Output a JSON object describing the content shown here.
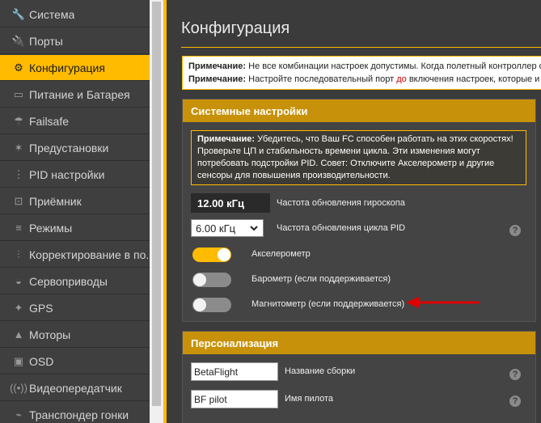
{
  "sidebar": {
    "items": [
      {
        "label": "Система",
        "icon": "wrench-icon",
        "glyph": "🔧"
      },
      {
        "label": "Порты",
        "icon": "plug-icon",
        "glyph": "🔌"
      },
      {
        "label": "Конфигурация",
        "icon": "gear-icon",
        "glyph": "⚙"
      },
      {
        "label": "Питание и Батарея",
        "icon": "battery-icon",
        "glyph": "▭"
      },
      {
        "label": "Failsafe",
        "icon": "parachute-icon",
        "glyph": "☂"
      },
      {
        "label": "Предустановки",
        "icon": "wand-icon",
        "glyph": "✶"
      },
      {
        "label": "PID настройки",
        "icon": "sliders-icon",
        "glyph": "⋮"
      },
      {
        "label": "Приёмник",
        "icon": "receiver-icon",
        "glyph": "⊡"
      },
      {
        "label": "Режимы",
        "icon": "toggle-icon",
        "glyph": "≡"
      },
      {
        "label": "Корректирование в по...",
        "icon": "adjust-icon",
        "glyph": "⫶"
      },
      {
        "label": "Сервоприводы",
        "icon": "servo-icon",
        "glyph": "◒"
      },
      {
        "label": "GPS",
        "icon": "satellite-icon",
        "glyph": "✦"
      },
      {
        "label": "Моторы",
        "icon": "motor-icon",
        "glyph": "▲"
      },
      {
        "label": "OSD",
        "icon": "osd-icon",
        "glyph": "▣"
      },
      {
        "label": "Видеопередатчик",
        "icon": "antenna-icon",
        "glyph": "((•))"
      },
      {
        "label": "Транспондер гонки",
        "icon": "transponder-icon",
        "glyph": "⌁"
      }
    ],
    "active_index": 2
  },
  "main": {
    "title": "Конфигурация",
    "notes": {
      "line1_bold": "Примечание:",
      "line1_text": " Не все комбинации настроек допустимы. Когда полетный контроллер о",
      "line2_bold": "Примечание:",
      "line2_text_a": " Настройте последовательный порт ",
      "line2_red": "до",
      "line2_text_b": " включения настроек, которые и"
    },
    "system_panel": {
      "title": "Системные настройки",
      "warning_bold": "Примечание:",
      "warning_text": " Убедитесь, что Ваш FC способен работать на этих скоростях! Проверьте ЦП и стабильность времени цикла. Эти изменения могут потребовать подстройки PID. Совет: Отключите Акселерометр и другие сенсоры для повышения производительности.",
      "gyro_value": "12.00 кГц",
      "gyro_label": "Частота обновления гироскопа",
      "pid_value": "6.00 кГц",
      "pid_label": "Частота обновления цикла PID",
      "accel_label": "Акселерометр",
      "accel_on": true,
      "baro_label": "Барометр (если поддерживается)",
      "baro_on": false,
      "mag_label": "Магнитометр (если поддерживается)",
      "mag_on": false,
      "help_glyph": "?"
    },
    "personal_panel": {
      "title": "Персонализация",
      "craft_name_value": "BetaFlight",
      "craft_name_label": "Название сборки",
      "pilot_name_value": "BF pilot",
      "pilot_name_label": "Имя пилота"
    }
  },
  "colors": {
    "accent": "#ffbb00",
    "panel_header": "#c7920a",
    "arrow": "#e00000"
  }
}
